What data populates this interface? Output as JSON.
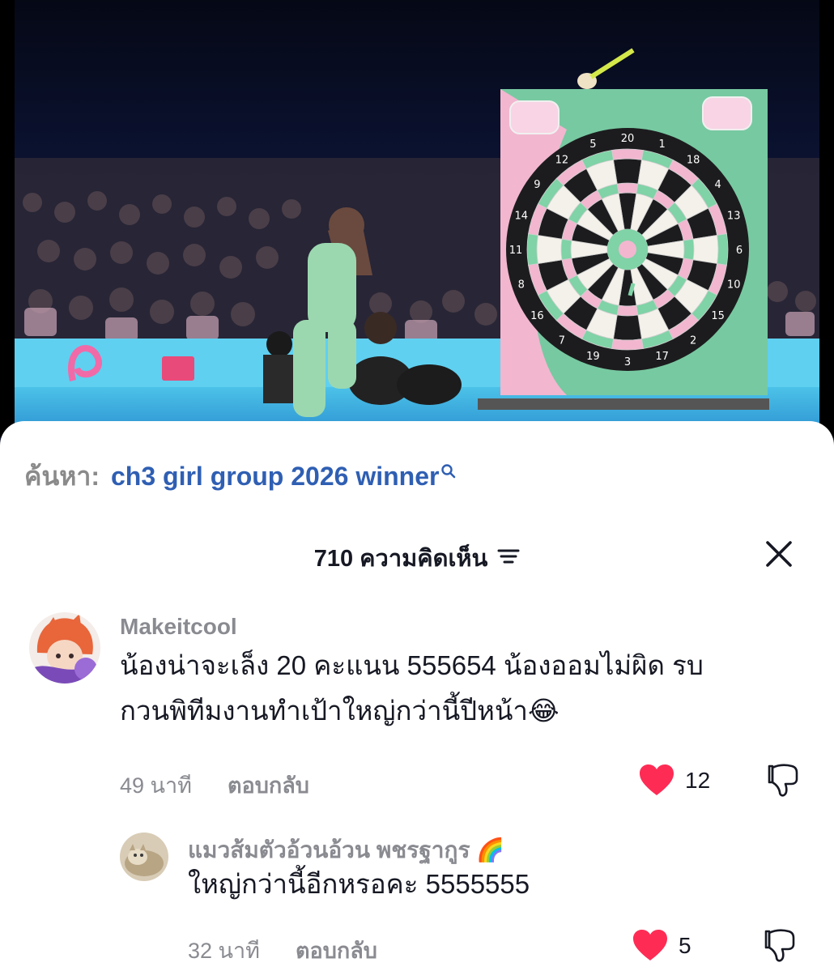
{
  "search": {
    "prefix": "ค้นหา:",
    "term": "ch3 girl group 2026 winner"
  },
  "comments_header": {
    "count_label": "710 ความคิดเห็น"
  },
  "video": {
    "board_numbers": [
      "20",
      "1",
      "18",
      "4",
      "13",
      "6",
      "10",
      "15",
      "2",
      "17",
      "3",
      "19",
      "7",
      "16",
      "8",
      "11",
      "14",
      "9",
      "12",
      "5"
    ]
  },
  "comments": [
    {
      "username": "Makeitcool",
      "text_line1": "น้องน่าจะเล็ง 20 คะแนน 555654 น้องออมไม่ผิด รบ",
      "text_line2": "กวนพิทีมงานทำเป้าใหญ่กว่านี้ปีหน้า😂",
      "time": "49 นาที",
      "reply_label": "ตอบกลับ",
      "likes": "12",
      "liked": true
    },
    {
      "username": "แมวส้มตัวอ้วนอ้วน พชรฐากูร 🌈",
      "text": "ใหญ่กว่านี้อีกหรอคะ 5555555",
      "time": "32 นาที",
      "reply_label": "ตอบกลับ",
      "likes": "5",
      "liked": true
    }
  ],
  "colors": {
    "accent_blue": "#2f5fb3",
    "like_red": "#fe2c55",
    "muted_text": "#8a8b91"
  }
}
